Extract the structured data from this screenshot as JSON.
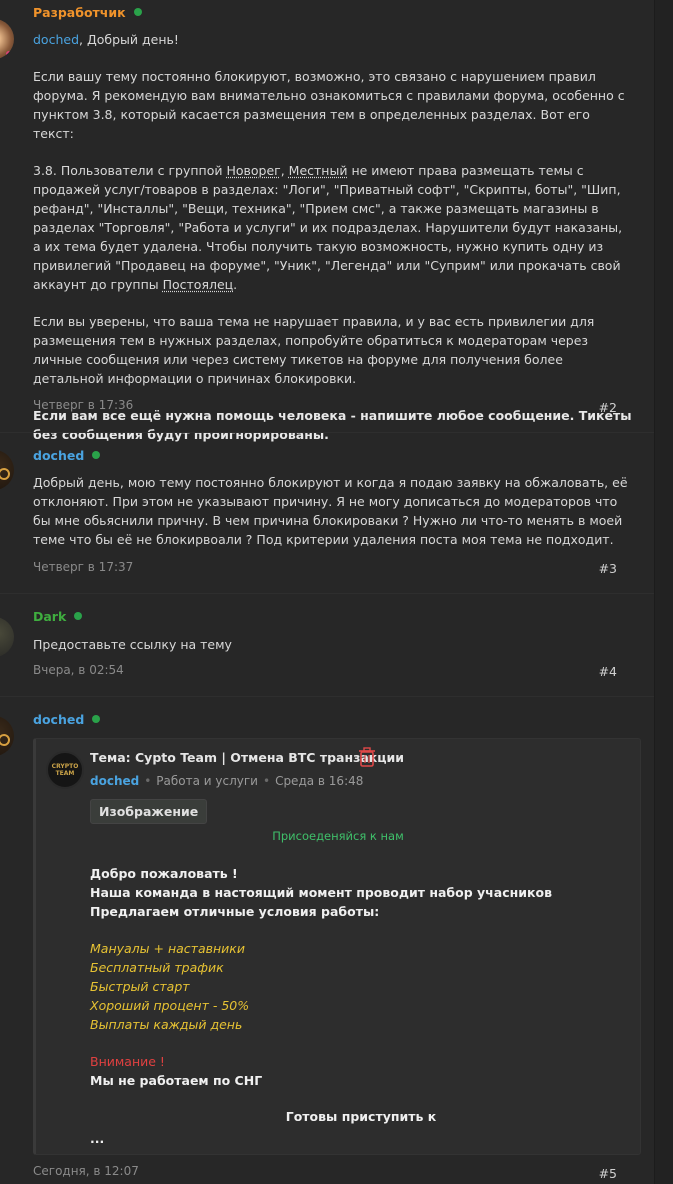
{
  "posts": [
    {
      "author": "Разработчик",
      "mention": "doched",
      "greeting": ", Добрый день!",
      "p1": "Если вашу тему постоянно блокируют, возможно, это связано с нарушением правил форума. Я рекомендую вам внимательно ознакомиться с правилами форума, особенно с пунктом 3.8, который касается размещения тем в определенных разделах. Вот его текст:",
      "p2a": "3.8. Пользователи с группой ",
      "p2_g1": "Новорег",
      "p2b": ", ",
      "p2_g2": "Местный",
      "p2c": " не имеют права размещать темы с продажей услуг/товаров в разделах: \"Логи\", \"Приватный софт\", \"Скрипты, боты\", \"Шип, рефанд\", \"Инсталлы\", \"Вещи, техника\", \"Прием смс\", а также размещать магазины в разделах \"Торговля\", \"Работа и услуги\" и их подразделах. Нарушители будут наказаны, а их тема будет удалена. Чтобы получить такую возможность, нужно купить одну из привилегий \"Продавец на форуме\", \"Уник\", \"Легенда\" или \"Суприм\" или прокачать свой аккаунт до группы ",
      "p2_g3": "Постоялец",
      "p2d": ".",
      "p3": "Если вы уверены, что ваша тема не нарушает правила, и у вас есть привилегии для размещения тем в нужных разделах, попробуйте обратиться к модераторам через личные сообщения или через систему тикетов на форуме для получения более детальной информации о причинах блокировки.",
      "p4": "Если вам все ещё нужна помощь человека - напишите любое сообщение. Тикеты без сообщения будут проигнорированы.",
      "date": "Четверг в 17:36",
      "number": "#2"
    },
    {
      "author": "doched",
      "text": "Добрый день, мою тему постоянно блокируют и когда я подаю заявку на обжаловать, её отклоняют. При этом не указывают причину. Я не могу дописаться до модераторов что бы мне обьяснили причну. В чем причина блокироваки ? Нужно ли что-то менять в моей теме что бы её не блокирвоали ? Под критерии удаления поста моя тема не подходит.",
      "date": "Четверг в 17:37",
      "number": "#3"
    },
    {
      "author": "Dark",
      "text": "Предоставьте ссылку на тему",
      "date": "Вчера, в 02:54",
      "number": "#4"
    },
    {
      "author": "doched",
      "date": "Сегодня, в 12:07",
      "number": "#5",
      "card": {
        "logo_line1": "CRYPTO",
        "logo_line2": "TEAM",
        "title": "Тема: Cypto Team | Отмена BTC транзакции",
        "author": "doched",
        "section": "Работа и услуги",
        "date": "Среда в 16:48",
        "image_button": "Изображение",
        "join_link": "Присоеденяйся к нам",
        "welcome": "Добро пожаловать !",
        "line2": "Наша команда в настоящий момент проводит набор учасников",
        "line3": "Предлагаем отличные условия работы:",
        "perks": [
          "Мануалы + наставники",
          "Бесплатный трафик",
          "Быстрый старт",
          "Хороший процент - 50%",
          "Выплаты каждый день"
        ],
        "warning": "Внимание !",
        "no_cis": "Мы не работаем по СНГ",
        "ready": "Готовы приступить к",
        "ellipsis": "..."
      }
    }
  ],
  "colors": {
    "developer": "#f0932b",
    "user": "#4aa3e0",
    "dark": "#3fae3f",
    "online": "#2aa24a",
    "perk": "#e6c233",
    "warning": "#e04040",
    "join": "#3fc06a"
  }
}
